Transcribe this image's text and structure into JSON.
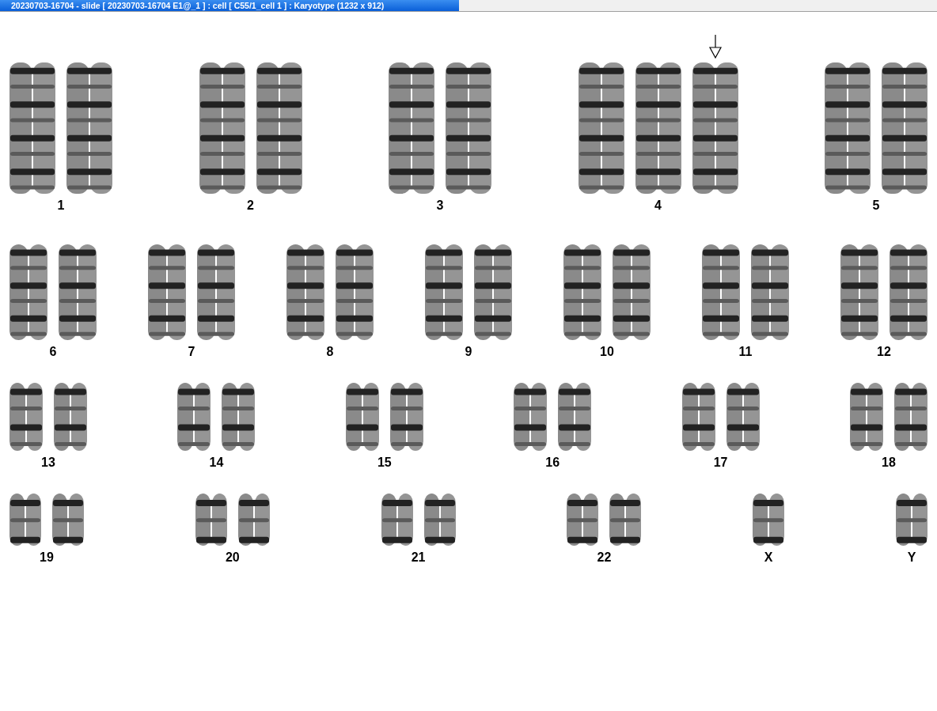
{
  "window": {
    "title": "20230703-16704 - slide [ 20230703-16704 E1@_1 ] : cell [ C55/1_cell 1 ] : Karyotype  (1232 x 912)"
  },
  "rows": [
    {
      "groups": [
        {
          "label": "1",
          "chromosomes": [
            {
              "marked": false
            },
            {
              "marked": false
            }
          ]
        },
        {
          "label": "2",
          "chromosomes": [
            {
              "marked": false
            },
            {
              "marked": false
            }
          ]
        },
        {
          "label": "3",
          "chromosomes": [
            {
              "marked": false
            },
            {
              "marked": false
            }
          ]
        },
        {
          "label": "4",
          "chromosomes": [
            {
              "marked": false
            },
            {
              "marked": false
            },
            {
              "marked": true
            }
          ]
        },
        {
          "label": "5",
          "chromosomes": [
            {
              "marked": false
            },
            {
              "marked": false
            }
          ]
        }
      ]
    },
    {
      "groups": [
        {
          "label": "6",
          "chromosomes": [
            {
              "marked": false
            },
            {
              "marked": false
            }
          ]
        },
        {
          "label": "7",
          "chromosomes": [
            {
              "marked": false
            },
            {
              "marked": false
            }
          ]
        },
        {
          "label": "8",
          "chromosomes": [
            {
              "marked": false
            },
            {
              "marked": false
            }
          ]
        },
        {
          "label": "9",
          "chromosomes": [
            {
              "marked": false
            },
            {
              "marked": false
            }
          ]
        },
        {
          "label": "10",
          "chromosomes": [
            {
              "marked": false
            },
            {
              "marked": false
            }
          ]
        },
        {
          "label": "11",
          "chromosomes": [
            {
              "marked": false
            },
            {
              "marked": false
            }
          ]
        },
        {
          "label": "12",
          "chromosomes": [
            {
              "marked": false
            },
            {
              "marked": false
            }
          ]
        }
      ]
    },
    {
      "groups": [
        {
          "label": "13",
          "chromosomes": [
            {
              "marked": false
            },
            {
              "marked": false
            }
          ]
        },
        {
          "label": "14",
          "chromosomes": [
            {
              "marked": false
            },
            {
              "marked": false
            }
          ]
        },
        {
          "label": "15",
          "chromosomes": [
            {
              "marked": false
            },
            {
              "marked": false
            }
          ]
        },
        {
          "label": "16",
          "chromosomes": [
            {
              "marked": false
            },
            {
              "marked": false
            }
          ]
        },
        {
          "label": "17",
          "chromosomes": [
            {
              "marked": false
            },
            {
              "marked": false
            }
          ]
        },
        {
          "label": "18",
          "chromosomes": [
            {
              "marked": false
            },
            {
              "marked": false
            }
          ]
        }
      ]
    },
    {
      "groups": [
        {
          "label": "19",
          "chromosomes": [
            {
              "marked": false
            },
            {
              "marked": false
            }
          ]
        },
        {
          "label": "20",
          "chromosomes": [
            {
              "marked": false
            },
            {
              "marked": false
            }
          ]
        },
        {
          "label": "21",
          "chromosomes": [
            {
              "marked": false
            },
            {
              "marked": false
            }
          ]
        },
        {
          "label": "22",
          "chromosomes": [
            {
              "marked": false
            },
            {
              "marked": false
            }
          ]
        },
        {
          "label": "X",
          "chromosomes": [
            {
              "marked": false
            }
          ]
        },
        {
          "label": "Y",
          "chromosomes": [
            {
              "marked": false
            }
          ]
        }
      ]
    }
  ]
}
